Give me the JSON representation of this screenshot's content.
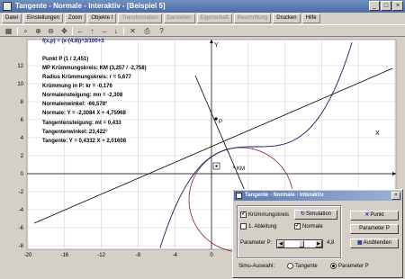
{
  "window": {
    "title": "Tangente - Normale - Interaktiv - [Beispiel 5]",
    "buttons": [
      "_",
      "□",
      "×"
    ]
  },
  "menu": [
    "Datei",
    "Einstellungen",
    "Zoom",
    "Objekte I",
    "Transformation",
    "Darstellen",
    "Eigenschaft",
    "Beschriftung",
    "Drucken",
    "Hilfe"
  ],
  "menu_disabled": [
    false,
    false,
    false,
    false,
    true,
    true,
    true,
    true,
    false,
    false
  ],
  "toolbar": {
    "icons": [
      "calculator-icon",
      "zoom-icon",
      "zoom-in-icon",
      "zoom-out-icon",
      "move-icon",
      "arrow-left-icon",
      "arrow-up-icon",
      "arrow-right-icon",
      "arrow-down-icon",
      "delete-icon",
      "print-icon",
      "help-icon"
    ],
    "glyphs": [
      "▦",
      "⌕",
      "⊕",
      "⊖",
      "✥",
      "←",
      "↑",
      "→",
      "↓",
      "✕",
      "⎙",
      "?"
    ]
  },
  "plot": {
    "formula": "f(x,p) = (x-(4,8))^3/100+3",
    "axis_x_letter": "X",
    "axis_y_letter": "Y",
    "x_ticks": [
      "-20",
      "-16",
      "-12",
      "-8",
      "-4",
      "0",
      "4",
      "8",
      "12",
      "16",
      "20"
    ],
    "y_ticks": [
      "12",
      "10",
      "8",
      "6",
      "4",
      "2",
      "0",
      "-2",
      "-4",
      "-6",
      "-8"
    ],
    "point_label": "P",
    "center_label": "KM",
    "colors": {
      "curve": "#1a1a6a",
      "circle": "#7a1a2a",
      "tangent": "#000000",
      "grid": "#c0c0c0",
      "axis": "#000000"
    }
  },
  "info": {
    "lines": [
      {
        "text": "Punkt P (1 / 2,451)",
        "color": "#1a1a9a"
      },
      {
        "text": "MP Krümmungskreis: KM (3,257 / -2,758)",
        "color": "#7a1a2a"
      },
      {
        "text": "Radius Krümmungskreis: r = 5,677",
        "color": "#7a1a2a"
      },
      {
        "text": "Krümmung in P: kr = -0,176",
        "color": "#7a1a2a"
      },
      {
        "text": "Normalensteigung: mn = -2,308",
        "color": "#6a1a5a"
      },
      {
        "text": "Normalenwinkel: -66,578°",
        "color": "#6a1a5a"
      },
      {
        "text": "Normale: Y = -2,3084 X + 4,75968",
        "color": "#6a1a5a"
      },
      {
        "text": "Tangentensteigung: mt = 0,433",
        "color": "#1a1a6a"
      },
      {
        "text": "Tangentenwinkel: 23,422°",
        "color": "#1a1a6a"
      },
      {
        "text": "Tangente: Y = 0,4332 X + 2,01608",
        "color": "#1a1a6a"
      }
    ]
  },
  "dialog": {
    "title": "Tangente - Normale - Interaktiv",
    "close": "×",
    "chk_kreis": "Krümmungskreis",
    "chk_kreis_checked": "✓",
    "simulation": "Simulation",
    "chk_ableitung": "1. Ableitung",
    "chk_normale": "Normale",
    "chk_normale_checked": "✓",
    "param_label": "Parameter P:",
    "param_value": "4,8",
    "param_fraction": 0.58,
    "punkt_btn": "Punkt",
    "param_btn": "Parameter P",
    "ausblenden_btn": "Ausblenden",
    "sim_label": "Simu-Auswahl:",
    "radio_tangente": "Tangente",
    "radio_param": "Parameter P"
  }
}
